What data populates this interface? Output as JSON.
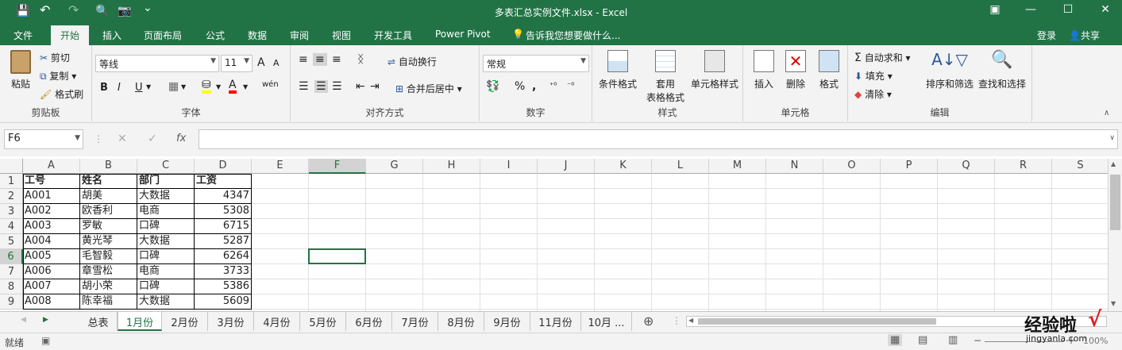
{
  "window": {
    "title": "多表汇总实例文件.xlsx - Excel"
  },
  "quick_access": {
    "save": "💾",
    "undo": "↶",
    "redo": "↷",
    "preview": "🔍",
    "camera": "📷",
    "more": "⌄"
  },
  "window_buttons": {
    "ribbon_display": "▣",
    "minimize": "—",
    "maximize": "☐",
    "close": "✕"
  },
  "tabs": [
    "文件",
    "开始",
    "插入",
    "页面布局",
    "公式",
    "数据",
    "审阅",
    "视图",
    "开发工具",
    "Power Pivot"
  ],
  "active_tab": "开始",
  "tell_me": "告诉我您想要做什么...",
  "account": {
    "login": "登录",
    "share": "共享"
  },
  "ribbon": {
    "clipboard": {
      "label": "剪贴板",
      "paste": "粘贴",
      "cut": "剪切",
      "copy": "复制",
      "format_painter": "格式刷"
    },
    "font": {
      "label": "字体",
      "name": "等线",
      "size": "11",
      "bold": "B",
      "italic": "I",
      "underline": "U",
      "grow": "A",
      "shrink": "A",
      "phonetic": "wén"
    },
    "alignment": {
      "label": "对齐方式",
      "wrap": "自动换行",
      "merge": "合并后居中"
    },
    "number": {
      "label": "数字",
      "format": "常规",
      "percent": "%",
      "comma": ","
    },
    "styles": {
      "label": "样式",
      "conditional": "条件格式",
      "table_1": "套用",
      "table_2": "表格格式",
      "cell_styles": "单元格样式"
    },
    "cells": {
      "label": "单元格",
      "insert": "插入",
      "delete": "删除",
      "format": "格式"
    },
    "editing": {
      "label": "编辑",
      "autosum": "自动求和",
      "fill": "填充",
      "clear": "清除",
      "sort": "排序和筛选",
      "find": "查找和选择"
    }
  },
  "formula_bar": {
    "name_box": "F6",
    "cancel": "✕",
    "enter": "✓",
    "fx": "fx",
    "formula": ""
  },
  "columns": [
    "A",
    "B",
    "C",
    "D",
    "E",
    "F",
    "G",
    "H",
    "I",
    "J",
    "K",
    "L",
    "M",
    "N",
    "O",
    "P",
    "Q",
    "R",
    "S"
  ],
  "rows": [
    "1",
    "2",
    "3",
    "4",
    "5",
    "6",
    "7",
    "8",
    "9"
  ],
  "selected_cell": "F6",
  "table": {
    "headers": [
      "工号",
      "姓名",
      "部门",
      "工资"
    ],
    "data": [
      [
        "A001",
        "胡美",
        "大数据",
        "4347"
      ],
      [
        "A002",
        "欧香利",
        "电商",
        "5308"
      ],
      [
        "A003",
        "罗敏",
        "口碑",
        "6715"
      ],
      [
        "A004",
        "黄光琴",
        "大数据",
        "5287"
      ],
      [
        "A005",
        "毛智毅",
        "口碑",
        "6264"
      ],
      [
        "A006",
        "章雪松",
        "电商",
        "3733"
      ],
      [
        "A007",
        "胡小荣",
        "口碑",
        "5386"
      ],
      [
        "A008",
        "陈幸福",
        "大数据",
        "5609"
      ]
    ]
  },
  "sheets": [
    "总表",
    "1月份",
    "2月份",
    "3月份",
    "4月份",
    "5月份",
    "6月份",
    "7月份",
    "8月份",
    "9月份",
    "11月份",
    "10月 ..."
  ],
  "active_sheet": "1月份",
  "status": {
    "ready": "就绪",
    "zoom": "100%"
  },
  "watermark": {
    "text": "经验啦",
    "url": "jingyanla.com",
    "check": "√"
  },
  "colors": {
    "accent": "#217346",
    "ribbon_bg": "#f3f3f3"
  }
}
